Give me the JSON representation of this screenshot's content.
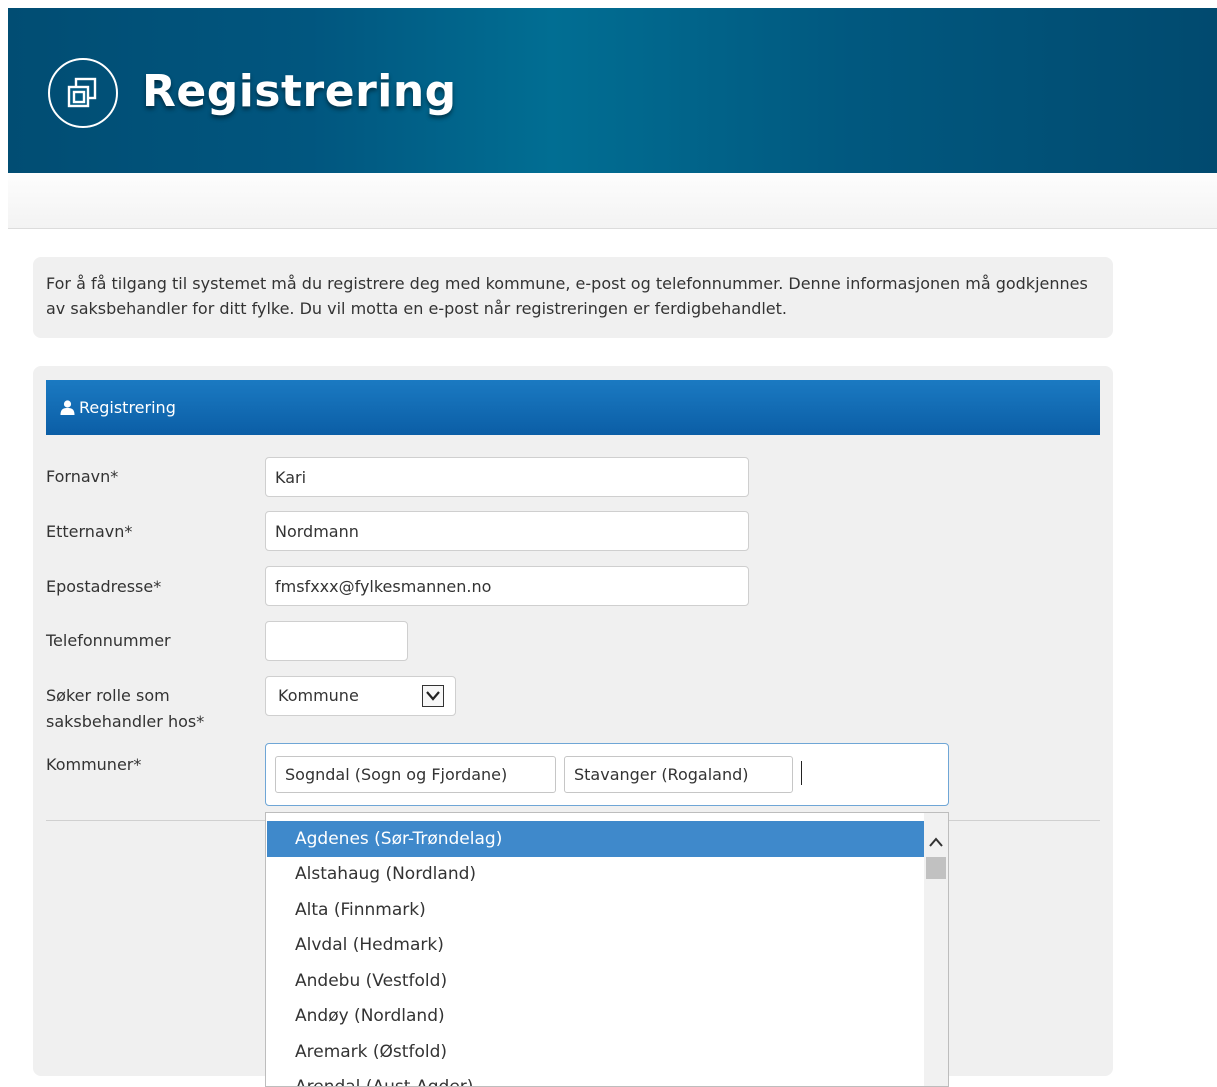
{
  "header": {
    "title": "Registrering",
    "logo_icon": "squares-logo-icon"
  },
  "info": {
    "text": "For å få tilgang til systemet må du registrere deg med kommune, e-post og telefonnummer. Denne informasjonen må godkjennes av saksbehandler for ditt fylke. Du vil motta en e-post når registreringen er ferdigbehandlet."
  },
  "panel": {
    "title": "Registrering",
    "title_icon": "user-icon"
  },
  "form": {
    "first_name": {
      "label": "Fornavn*",
      "value": "Kari"
    },
    "last_name": {
      "label": "Etternavn*",
      "value": "Nordmann"
    },
    "email": {
      "label": "Epostadresse*",
      "value": "fmsfxxx@fylkesmannen.no"
    },
    "phone": {
      "label": "Telefonnummer",
      "value": ""
    },
    "role": {
      "label_line1": "Søker rolle som",
      "label_line2": "saksbehandler hos*",
      "selected": "Kommune"
    },
    "municipalities": {
      "label": "Kommuner*",
      "chips": [
        "Sogndal (Sogn og Fjordane)",
        "Stavanger (Rogaland)"
      ]
    }
  },
  "dropdown": {
    "items": [
      "Agdenes (Sør-Trøndelag)",
      "Alstahaug (Nordland)",
      "Alta (Finnmark)",
      "Alvdal (Hedmark)",
      "Andebu (Vestfold)",
      "Andøy (Nordland)",
      "Aremark (Østfold)",
      "Arendal (Aust-Agder)"
    ],
    "highlighted_index": 0
  },
  "colors": {
    "header_bg": "#01567f",
    "panel_head": "#0f66ad",
    "highlight": "#3f89cb"
  }
}
